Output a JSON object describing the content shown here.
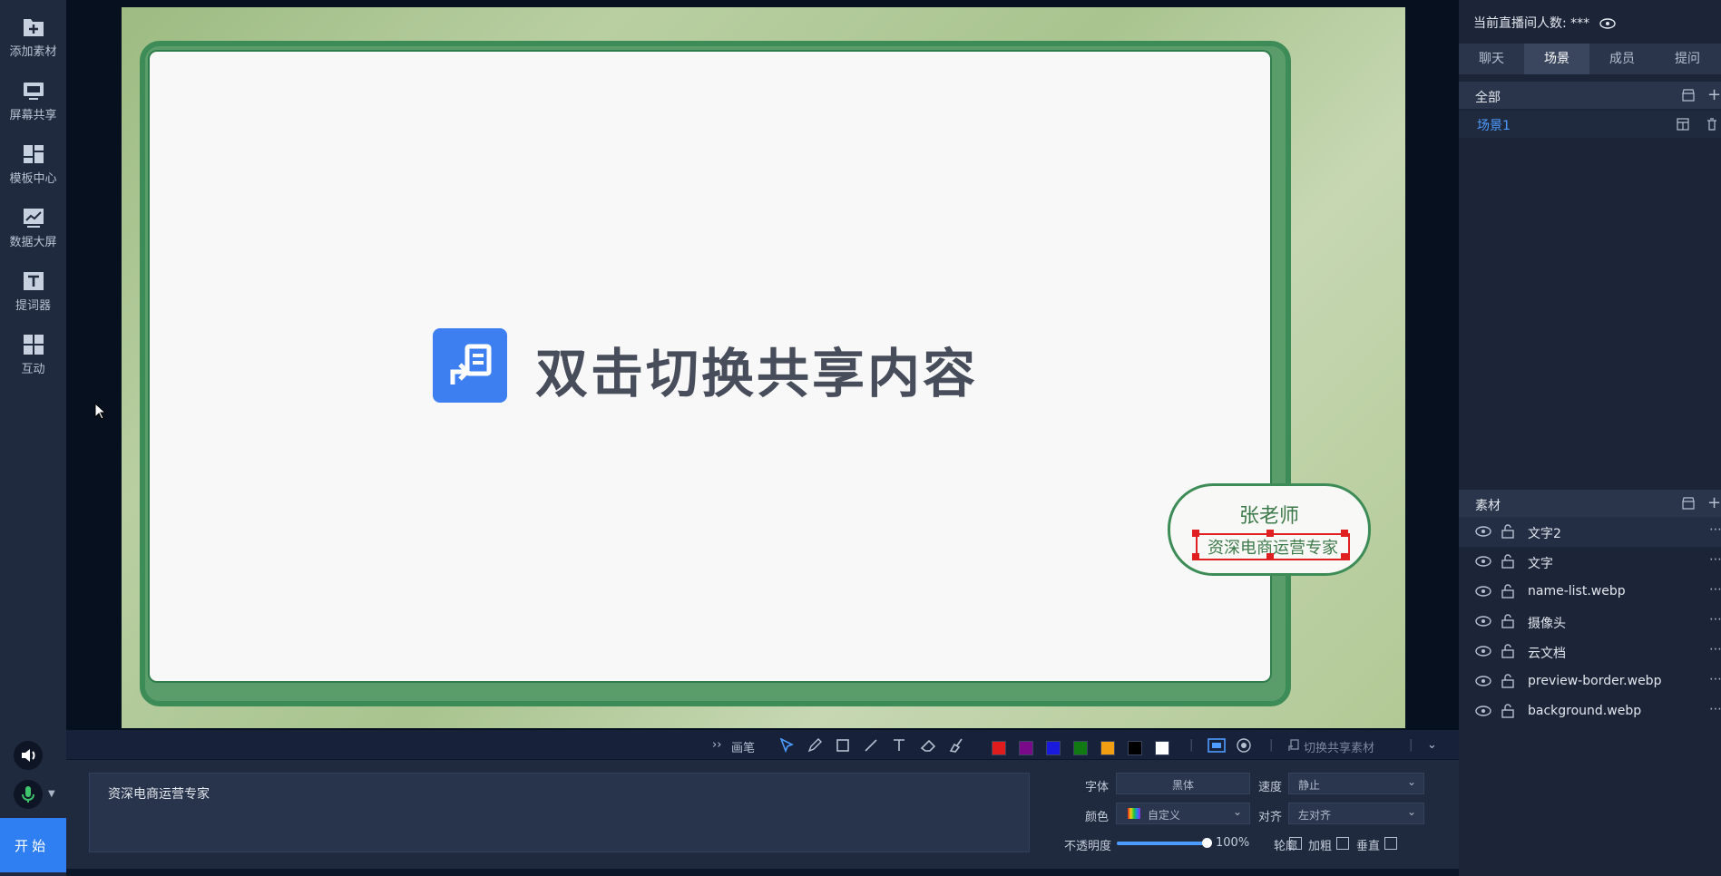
{
  "sidebar": {
    "items": [
      {
        "label": "添加素材",
        "icon": "add-material-icon"
      },
      {
        "label": "屏幕共享",
        "icon": "screen-share-icon"
      },
      {
        "label": "模板中心",
        "icon": "template-icon"
      },
      {
        "label": "数据大屏",
        "icon": "data-screen-icon"
      },
      {
        "label": "提词器",
        "icon": "teleprompter-icon"
      },
      {
        "label": "互动",
        "icon": "interaction-icon"
      }
    ],
    "start_label": "开 始"
  },
  "stage": {
    "share_text": "双击切换共享内容",
    "name_card": {
      "name": "张老师",
      "title": "资深电商运营专家"
    }
  },
  "toolbar": {
    "brush_label": "画笔",
    "share_material_label": "切换共享素材",
    "colors": [
      "#e01c1c",
      "#7a0a8a",
      "#1a1adc",
      "#127a12",
      "#f2a012",
      "#000000",
      "#ffffff"
    ]
  },
  "props": {
    "text_value": "资深电商运营专家",
    "font_label": "字体",
    "font_value": "黑体",
    "speed_label": "速度",
    "speed_value": "静止",
    "color_label": "颜色",
    "color_value": "自定义",
    "align_label": "对齐",
    "align_value": "左对齐",
    "opacity_label": "不透明度",
    "opacity_value": "100%",
    "opacity_fraction": 1.0,
    "outline_label": "轮廓",
    "bold_label": "加粗",
    "vertical_label": "垂直"
  },
  "right": {
    "viewer_count": "当前直播间人数: ***",
    "tabs": [
      "聊天",
      "场景",
      "成员",
      "提问"
    ],
    "active_tab": "场景",
    "scenes_header": "全部",
    "scene": "场景1",
    "materials_header": "素材",
    "materials": [
      "文字2",
      "文字",
      "name-list.webp",
      "摄像头",
      "云文档",
      "preview-border.webp",
      "background.webp"
    ]
  },
  "accent": "#2f7ff2"
}
